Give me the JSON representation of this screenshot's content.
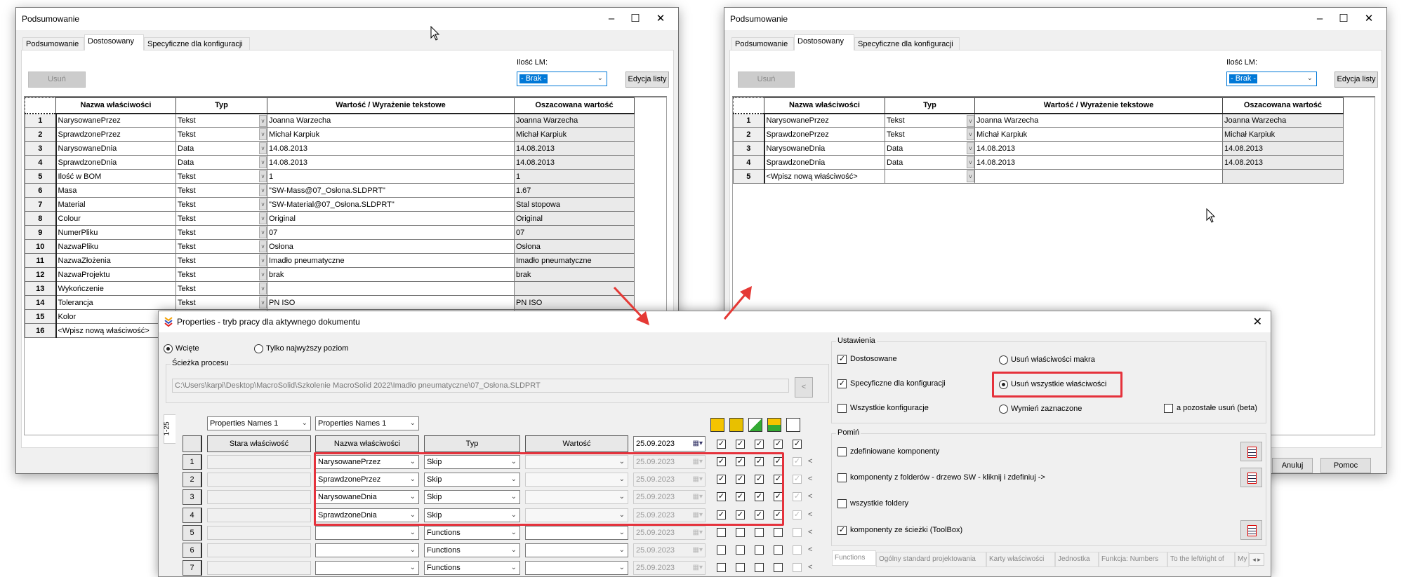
{
  "colors": {
    "accent": "#0078d7",
    "highlight": "#e5323c",
    "icon_yellow": "#f5c400"
  },
  "left_window": {
    "title": "Podsumowanie",
    "tabs": [
      "Podsumowanie",
      "Dostosowany",
      "Specyficzne dla konfiguracji"
    ],
    "selected_tab": "Dostosowany",
    "delete_button": "Usuń",
    "lm_label": "Ilość LM:",
    "lm_value": "- Brak -",
    "edit_list_button": "Edycja listy",
    "columns": [
      "Nazwa właściwości",
      "Typ",
      "Wartość / Wyrażenie tekstowe",
      "Oszacowana wartość"
    ],
    "rows": [
      [
        "1",
        "NarysowanePrzez",
        "Tekst",
        "Joanna Warzecha",
        "Joanna Warzecha"
      ],
      [
        "2",
        "SprawdzonePrzez",
        "Tekst",
        "Michał Karpiuk",
        "Michał Karpiuk"
      ],
      [
        "3",
        "NarysowaneDnia",
        "Data",
        "14.08.2013",
        "14.08.2013"
      ],
      [
        "4",
        "SprawdzoneDnia",
        "Data",
        "14.08.2013",
        "14.08.2013"
      ],
      [
        "5",
        "Ilość w BOM",
        "Tekst",
        "1",
        "1"
      ],
      [
        "6",
        "Masa",
        "Tekst",
        "\"SW-Mass@07_Osłona.SLDPRT\"",
        "1.67"
      ],
      [
        "7",
        "Material",
        "Tekst",
        "\"SW-Material@07_Osłona.SLDPRT\"",
        "Stal stopowa"
      ],
      [
        "8",
        "Colour",
        "Tekst",
        "Original",
        "Original"
      ],
      [
        "9",
        "NumerPliku",
        "Tekst",
        "07",
        "07"
      ],
      [
        "10",
        "NazwaPliku",
        "Tekst",
        "Osłona",
        "Osłona"
      ],
      [
        "11",
        "NazwaZłożenia",
        "Tekst",
        "Imadło pneumatyczne",
        "Imadło pneumatyczne"
      ],
      [
        "12",
        "NazwaProjektu",
        "Tekst",
        "brak",
        "brak"
      ],
      [
        "13",
        "Wykończenie",
        "Tekst",
        "",
        ""
      ],
      [
        "14",
        "Tolerancja",
        "Tekst",
        "PN ISO",
        "PN ISO"
      ],
      [
        "15",
        "Kolor",
        "",
        "",
        ""
      ],
      [
        "16",
        "<Wpisz nową właściwość>",
        "",
        "",
        ""
      ]
    ]
  },
  "right_window": {
    "title": "Podsumowanie",
    "tabs": [
      "Podsumowanie",
      "Dostosowany",
      "Specyficzne dla konfiguracji"
    ],
    "selected_tab": "Dostosowany",
    "delete_button": "Usuń",
    "lm_label": "Ilość LM:",
    "lm_value": "- Brak -",
    "edit_list_button": "Edycja listy",
    "cancel_button": "Anuluj",
    "help_button": "Pomoc",
    "columns": [
      "Nazwa właściwości",
      "Typ",
      "Wartość / Wyrażenie tekstowe",
      "Oszacowana wartość"
    ],
    "rows": [
      [
        "1",
        "NarysowanePrzez",
        "Tekst",
        "Joanna Warzecha",
        "Joanna Warzecha"
      ],
      [
        "2",
        "SprawdzonePrzez",
        "Tekst",
        "Michał Karpiuk",
        "Michał Karpiuk"
      ],
      [
        "3",
        "NarysowaneDnia",
        "Data",
        "14.08.2013",
        "14.08.2013"
      ],
      [
        "4",
        "SprawdzoneDnia",
        "Data",
        "14.08.2013",
        "14.08.2013"
      ],
      [
        "5",
        "<Wpisz nową właściwość>",
        "",
        "",
        ""
      ]
    ]
  },
  "dialog": {
    "title": "Properties  - tryb pracy dla aktywnego dokumentu",
    "mode_radios": [
      {
        "label": "Wcięte",
        "selected": true
      },
      {
        "label": "Tylko najwyższy poziom",
        "selected": false
      }
    ],
    "path_group": "Ścieżka procesu",
    "path_value": "C:\\Users\\karpi\\Desktop\\MacroSolid\\Szkolenie MacroSolid 2022\\Imadło pneumatyczne\\07_Osłona.SLDPRT",
    "path_button": "<",
    "page_tab": "1-25",
    "names_dropdown_1": "Properties Names 1",
    "names_dropdown_2": "Properties Names 1",
    "toolbar_icons": [
      "part-icon",
      "assembly-icon",
      "drawing-icon",
      "part-green-icon",
      "config-icon"
    ],
    "grid_columns": [
      "Stara właściwość",
      "Nazwa właściwości",
      "Typ",
      "Wartość"
    ],
    "header_date": "25.09.2023",
    "header_checks": [
      true,
      true,
      true,
      true,
      true
    ],
    "grid_rows": [
      {
        "num": "1",
        "old": "",
        "name": "NarysowanePrzez",
        "type": "Skip",
        "value": "",
        "date": "25.09.2023",
        "checks": [
          true,
          true,
          true,
          true,
          true
        ]
      },
      {
        "num": "2",
        "old": "",
        "name": "SprawdzonePrzez",
        "type": "Skip",
        "value": "",
        "date": "25.09.2023",
        "checks": [
          true,
          true,
          true,
          true,
          true
        ]
      },
      {
        "num": "3",
        "old": "",
        "name": "NarysowaneDnia",
        "type": "Skip",
        "value": "",
        "date": "25.09.2023",
        "checks": [
          true,
          true,
          true,
          true,
          true
        ]
      },
      {
        "num": "4",
        "old": "",
        "name": "SprawdzoneDnia",
        "type": "Skip",
        "value": "",
        "date": "25.09.2023",
        "checks": [
          true,
          true,
          true,
          true,
          true
        ]
      },
      {
        "num": "5",
        "old": "",
        "name": "",
        "type": "Functions",
        "value": "",
        "date": "25.09.2023",
        "checks": [
          false,
          false,
          false,
          false,
          false
        ]
      },
      {
        "num": "6",
        "old": "",
        "name": "",
        "type": "Functions",
        "value": "",
        "date": "25.09.2023",
        "checks": [
          false,
          false,
          false,
          false,
          false
        ]
      },
      {
        "num": "7",
        "old": "",
        "name": "",
        "type": "Functions",
        "value": "",
        "date": "25.09.2023",
        "checks": [
          false,
          false,
          false,
          false,
          false
        ]
      }
    ],
    "row_arrow": "<",
    "settings": {
      "label": "Ustawienia",
      "checkboxes": [
        {
          "label": "Dostosowane",
          "checked": true
        },
        {
          "label": "Specyficzne dla konfiguracji",
          "checked": true
        },
        {
          "label": "Wszystkie konfiguracje",
          "checked": false
        }
      ],
      "radios": [
        {
          "label": "Usuń właściwości makra",
          "selected": false
        },
        {
          "label": "Usuń wszystkie właściwości",
          "selected": true
        },
        {
          "label": "Wymień zaznaczone",
          "selected": false
        }
      ],
      "beta_checkbox": {
        "label": "a pozostałe usuń (beta)",
        "checked": false
      }
    },
    "skip": {
      "label": "Pomiń",
      "items": [
        {
          "label": "zdefiniowane komponenty",
          "checked": false,
          "has_button": true
        },
        {
          "label": "komponenty z folderów - drzewo SW - kliknij i zdefiniuj ->",
          "checked": false,
          "has_button": true
        },
        {
          "label": "wszystkie foldery",
          "checked": false,
          "has_button": false
        },
        {
          "label": "komponenty ze ścieżki (ToolBox)",
          "checked": true,
          "has_button": true
        }
      ]
    },
    "bottom_tabs": [
      "Functions",
      "Ogólny standard projektowania",
      "Karty właściwości",
      "Jednostka",
      "Funkcja: Numbers",
      "To the left/right of",
      "My"
    ]
  }
}
